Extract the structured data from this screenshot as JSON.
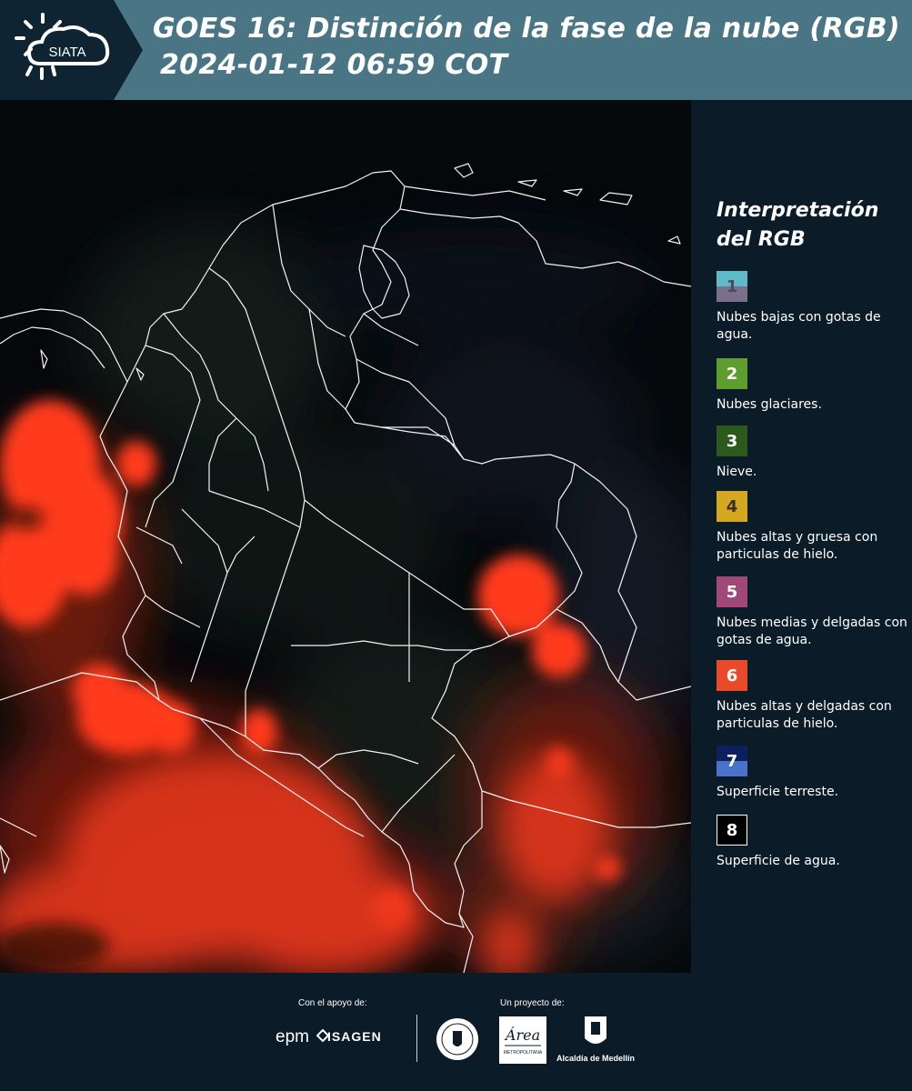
{
  "header": {
    "title_line1": "GOES 16: Distinción de la fase de la nube (RGB)",
    "title_line2": "2024-01-12 06:59 COT",
    "logo_text": "SIATA"
  },
  "legend": {
    "title": "Interpretación del RGB",
    "items": [
      {
        "number": "1",
        "label": "Nubes bajas con gotas de agua.",
        "color_top": "#5fb9c9",
        "color_bottom": "#7a6f8c",
        "text_color": "#4a4a5a"
      },
      {
        "number": "2",
        "label": "Nubes glaciares.",
        "color_top": "#5f9e2e",
        "color_bottom": "#5f9e2e",
        "text_color": "#ffffff"
      },
      {
        "number": "3",
        "label": "Nieve.",
        "color_top": "#2c5a1c",
        "color_bottom": "#2c5a1c",
        "text_color": "#ffffff"
      },
      {
        "number": "4",
        "label": "Nubes altas y gruesa con particulas de hielo.",
        "color_top": "#d4a820",
        "color_bottom": "#d4a820",
        "text_color": "#3a3020"
      },
      {
        "number": "5",
        "label": "Nubes medias y delgadas con gotas de agua.",
        "color_top": "#a04878",
        "color_bottom": "#a04878",
        "text_color": "#ffffff"
      },
      {
        "number": "6",
        "label": "Nubes altas y delgadas con particulas de hielo.",
        "color_top": "#e84a2a",
        "color_bottom": "#e84a2a",
        "text_color": "#ffffff"
      },
      {
        "number": "7",
        "label": "Superficie terreste.",
        "color_top": "#0d1f5c",
        "color_bottom": "#4a72c8",
        "text_color": "#ffffff"
      },
      {
        "number": "8",
        "label": "Superficie de agua.",
        "color_top": "#000000",
        "color_bottom": "#000000",
        "text_color": "#ffffff"
      }
    ]
  },
  "footer": {
    "support_label": "Con el apoyo de:",
    "project_label": "Un proyecto de:",
    "epm": "epm",
    "isagen": "ISAGEN",
    "alcaldia": "Alcaldía de Medellín"
  },
  "colors": {
    "header_bg": "#4a7585",
    "header_logo_bg": "#0e2433",
    "page_bg": "#0b1c28",
    "cloud_red": "#ff3a1e"
  }
}
